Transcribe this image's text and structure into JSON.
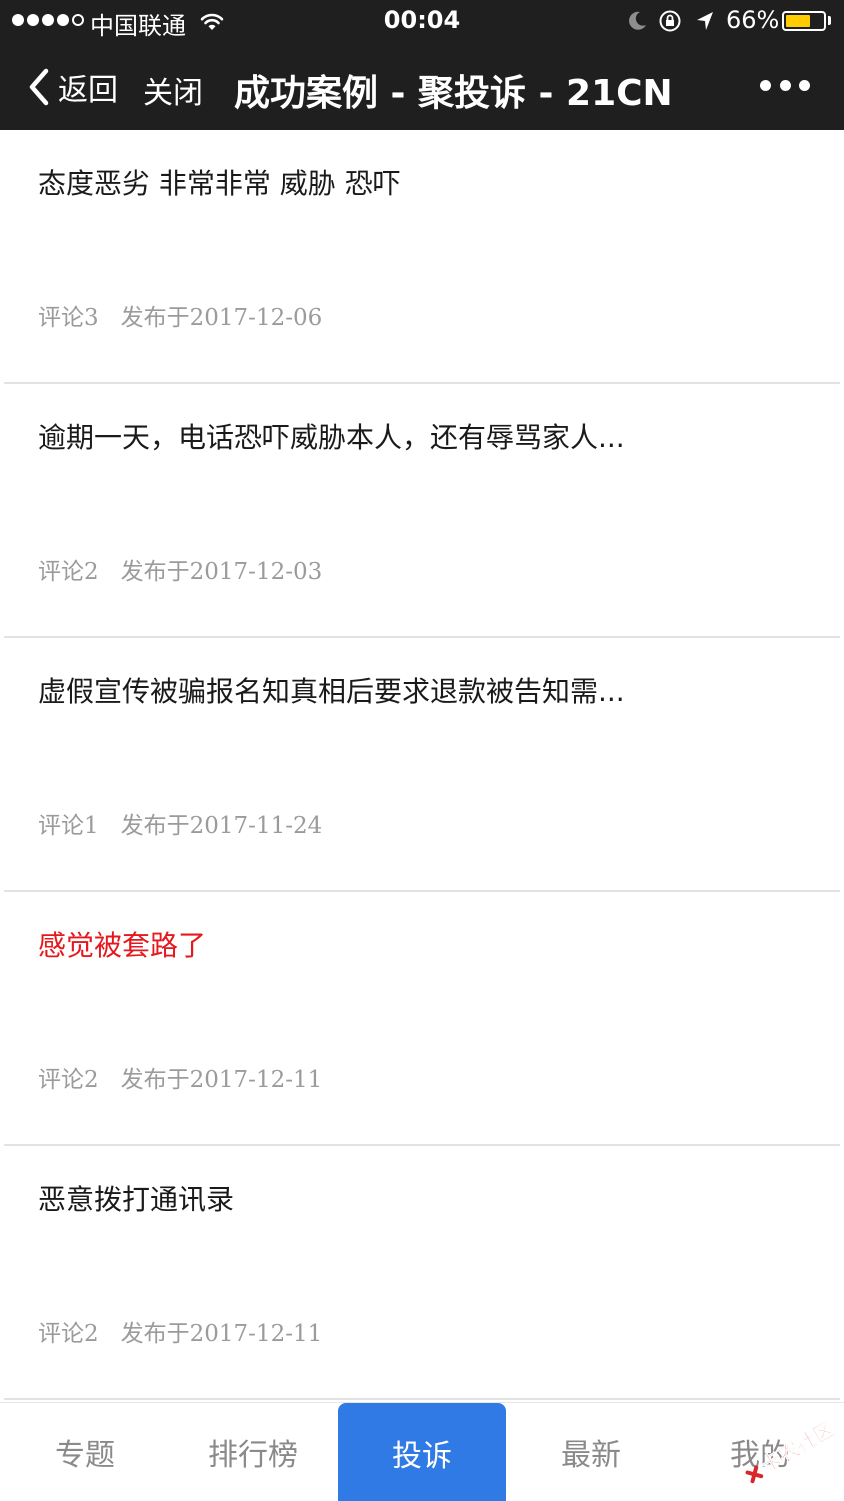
{
  "status_bar": {
    "carrier": "中国联通",
    "time": "00:04",
    "battery_percent": "66%",
    "battery_level": 0.66,
    "signal_bars_filled": 4,
    "signal_bars_total": 5
  },
  "nav": {
    "back_label": "返回",
    "close_label": "关闭",
    "title": "成功案例 - 聚投诉 - 21CN"
  },
  "list": {
    "items": [
      {
        "title": "态度恶劣 非常非常 威胁 恐吓",
        "comments": "评论3",
        "date": "发布于2017-12-06"
      },
      {
        "title": "逾期一天，电话恐吓威胁本人，还有辱骂家人...",
        "comments": "评论2",
        "date": "发布于2017-12-03"
      },
      {
        "title": "虚假宣传被骗报名知真相后要求退款被告知需...",
        "comments": "评论1",
        "date": "发布于2017-11-24"
      },
      {
        "title": "感觉被套路了",
        "comments": "评论2",
        "date": "发布于2017-12-11"
      },
      {
        "title": "恶意拨打通讯录",
        "comments": "评论2",
        "date": "发布于2017-12-11"
      }
    ]
  },
  "tabbar": {
    "tabs": [
      {
        "label": "专题"
      },
      {
        "label": "排行榜"
      },
      {
        "label": "投诉"
      },
      {
        "label": "最新"
      },
      {
        "label": "我的"
      }
    ]
  },
  "watermark": {
    "text": "卡农社区"
  },
  "colors": {
    "header_bg": "#1f1f1f",
    "accent_blue": "#2f7ae5",
    "highlight_red": "#e5191d",
    "battery_yellow": "#ffcc00",
    "meta_gray": "#9b9b9b"
  }
}
